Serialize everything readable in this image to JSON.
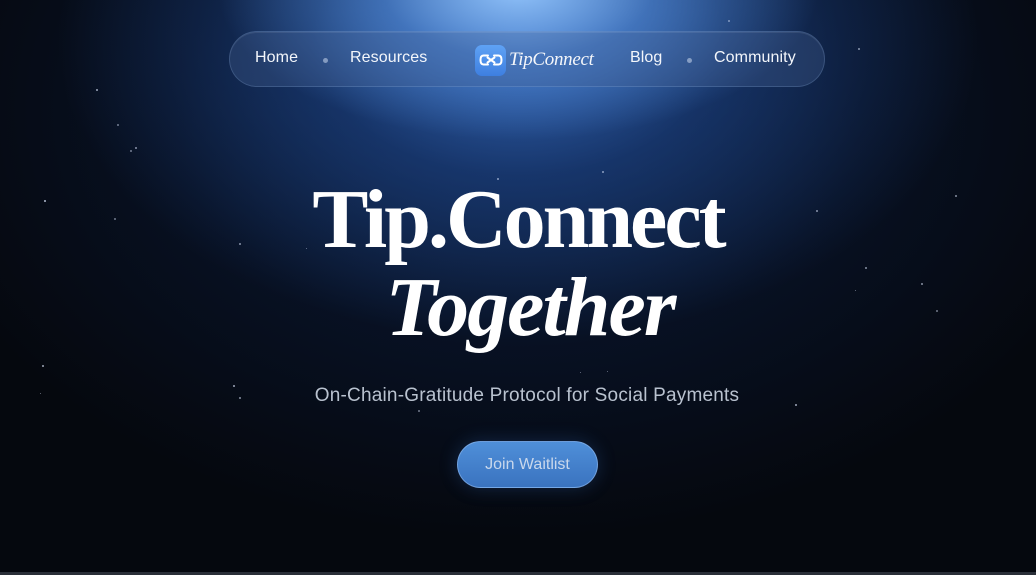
{
  "nav": {
    "items_left": [
      "Home",
      "Resources"
    ],
    "items_right": [
      "Blog",
      "Community"
    ],
    "logo_text": "TipConnect"
  },
  "hero": {
    "title_line1": "Tip.Connect",
    "title_line2": "Together",
    "subtitle": "On-Chain-Gratitude Protocol for Social Payments",
    "cta_label": "Join Waitlist"
  },
  "colors": {
    "background": "#05080e",
    "glow": "#6fa7ef",
    "accent": "#4a87d3",
    "text": "#ffffff"
  },
  "icons": {
    "logo": "link-infinity-icon"
  }
}
